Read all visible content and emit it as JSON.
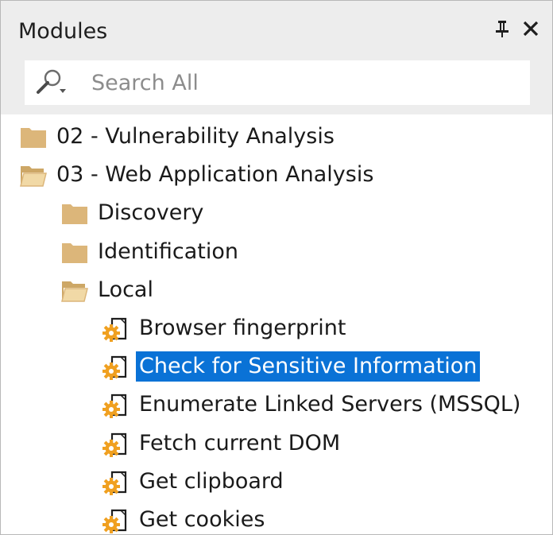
{
  "panel": {
    "title": "Modules",
    "pin_icon": "pin-icon",
    "close_icon": "close-icon"
  },
  "search": {
    "placeholder": "Search All",
    "value": "",
    "icon": "search-icon"
  },
  "tree": {
    "selected_color": "#0a72d6",
    "folder_color": "#dcb67a",
    "module_gear_color": "#f0a020",
    "items": [
      {
        "label": "02 - Vulnerability Analysis",
        "icon": "folder-closed-icon",
        "level": 0
      },
      {
        "label": "03 - Web Application Analysis",
        "icon": "folder-open-icon",
        "level": 0
      },
      {
        "label": "Discovery",
        "icon": "folder-closed-icon",
        "level": 1
      },
      {
        "label": "Identification",
        "icon": "folder-closed-icon",
        "level": 1
      },
      {
        "label": "Local",
        "icon": "folder-open-icon",
        "level": 1
      },
      {
        "label": "Browser fingerprint",
        "icon": "module-icon",
        "level": 2
      },
      {
        "label": "Check for Sensitive Information",
        "icon": "module-icon",
        "level": 2,
        "selected": true
      },
      {
        "label": "Enumerate Linked Servers (MSSQL)",
        "icon": "module-icon",
        "level": 2
      },
      {
        "label": "Fetch current DOM",
        "icon": "module-icon",
        "level": 2
      },
      {
        "label": "Get clipboard",
        "icon": "module-icon",
        "level": 2
      },
      {
        "label": "Get cookies",
        "icon": "module-icon",
        "level": 2
      }
    ]
  }
}
